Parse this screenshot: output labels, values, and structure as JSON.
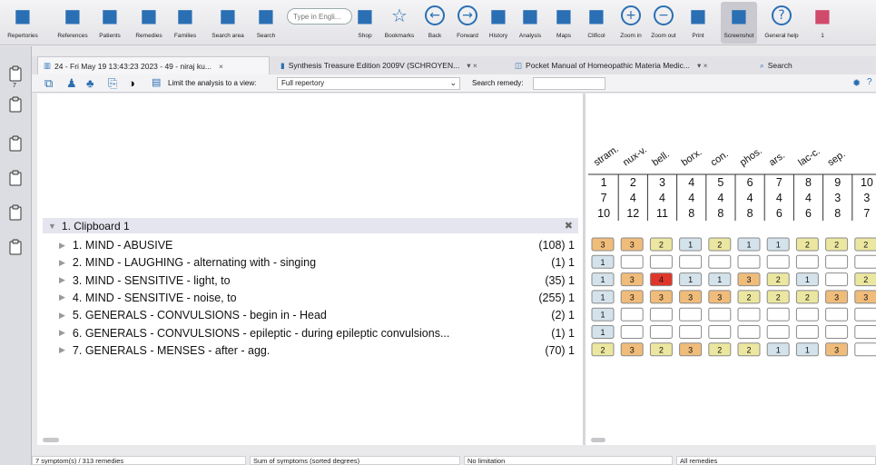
{
  "toolbar": {
    "items": [
      {
        "label": "Repertories",
        "icon": "repertories-icon"
      },
      {
        "label": "References",
        "icon": "book-icon"
      },
      {
        "label": "Patients",
        "icon": "patients-icon"
      },
      {
        "label": "Remedies",
        "icon": "bottle-icon"
      },
      {
        "label": "Families",
        "icon": "tree-icon"
      },
      {
        "label": "Search area",
        "icon": "search-area-icon"
      },
      {
        "label": "Search",
        "icon": "magnifier-icon"
      },
      {
        "label": "Shop",
        "icon": "cart-icon"
      },
      {
        "label": "Bookmarks",
        "icon": "star-icon"
      },
      {
        "label": "Back",
        "icon": "back-arrow-icon"
      },
      {
        "label": "Forward",
        "icon": "forward-arrow-icon"
      },
      {
        "label": "History",
        "icon": "history-icon"
      },
      {
        "label": "Analysis",
        "icon": "bar-chart-icon"
      },
      {
        "label": "Maps",
        "icon": "maps-icon"
      },
      {
        "label": "Clificol",
        "icon": "clificol-icon"
      },
      {
        "label": "Zoom in",
        "icon": "zoom-in-icon"
      },
      {
        "label": "Zoom out",
        "icon": "zoom-out-icon"
      },
      {
        "label": "Print",
        "icon": "printer-icon"
      },
      {
        "label": "Screenshot",
        "icon": "camera-icon"
      },
      {
        "label": "General help",
        "icon": "help-icon"
      },
      {
        "label": "1",
        "icon": "gift-icon"
      }
    ],
    "search_placeholder": "Type in Engli...",
    "accent": "#2a6fb3"
  },
  "sidebar": {
    "badge": "7"
  },
  "tabs": [
    {
      "label": "24 - Fri May 19 13:43:23 2023 - 49 - niraj  ku...",
      "close": "×"
    },
    {
      "label": "Synthesis Treasure Edition 2009V (SCHROYEN...",
      "close": "▾ ×"
    },
    {
      "label": "Pocket Manual of Homeopathic Materia Medic...",
      "close": "▾ ×"
    },
    {
      "label": "Search",
      "close": ""
    }
  ],
  "options": {
    "limit_label": "Limit the analysis to a view:",
    "view_value": "Full repertory",
    "search_remedy_label": "Search remedy:",
    "search_remedy_value": ""
  },
  "clipboard": {
    "title": "1. Clipboard 1",
    "rubrics": [
      {
        "text": "1. MIND - ABUSIVE",
        "count": "(108) 1"
      },
      {
        "text": "2. MIND - LAUGHING - alternating with - singing",
        "count": "(1) 1"
      },
      {
        "text": "3. MIND - SENSITIVE - light, to",
        "count": "(35) 1"
      },
      {
        "text": "4. MIND - SENSITIVE - noise, to",
        "count": "(255) 1"
      },
      {
        "text": "5. GENERALS - CONVULSIONS - begin in - Head",
        "count": "(2) 1"
      },
      {
        "text": "6. GENERALS - CONVULSIONS - epileptic - during epileptic convulsions...",
        "count": "(1) 1"
      },
      {
        "text": "7. GENERALS - MENSES - after - agg.",
        "count": "(70) 1"
      }
    ]
  },
  "analysis": {
    "remedies": [
      "stram.",
      "nux-v.",
      "bell.",
      "borx.",
      "con.",
      "phos.",
      "ars.",
      "lac-c.",
      "sep."
    ],
    "rank": [
      "1",
      "2",
      "3",
      "4",
      "5",
      "6",
      "7",
      "8",
      "9",
      "10"
    ],
    "symptoms_covered": [
      "7",
      "4",
      "4",
      "4",
      "4",
      "4",
      "4",
      "4",
      "3",
      "3"
    ],
    "total_degrees": [
      "10",
      "12",
      "11",
      "8",
      "8",
      "8",
      "6",
      "6",
      "8",
      "7"
    ],
    "grades": [
      [
        "3",
        "3",
        "2",
        "1",
        "2",
        "1",
        "1",
        "2",
        "2",
        "2"
      ],
      [
        "1",
        "",
        "",
        "",
        "",
        "",
        "",
        "",
        "",
        ""
      ],
      [
        "1",
        "3",
        "4",
        "1",
        "1",
        "3",
        "2",
        "1",
        "",
        "2"
      ],
      [
        "1",
        "3",
        "3",
        "3",
        "3",
        "2",
        "2",
        "2",
        "3",
        "3"
      ],
      [
        "1",
        "",
        "",
        "",
        "",
        "",
        "",
        "",
        "",
        ""
      ],
      [
        "1",
        "",
        "",
        "",
        "",
        "",
        "",
        "",
        "",
        ""
      ],
      [
        "2",
        "3",
        "2",
        "3",
        "2",
        "2",
        "1",
        "1",
        "3",
        ""
      ]
    ],
    "grade_colors": {
      "1": "#d4e2ec",
      "2": "#ece7a0",
      "3": "#f0bc7a",
      "4": "#e0352b",
      "": "#ffffff"
    }
  },
  "status": {
    "symptoms": "7 symptom(s) / 313 remedies",
    "sort": "Sum of symptoms (sorted degrees)",
    "limitation": "No limitation",
    "remedies": "All remedies"
  }
}
